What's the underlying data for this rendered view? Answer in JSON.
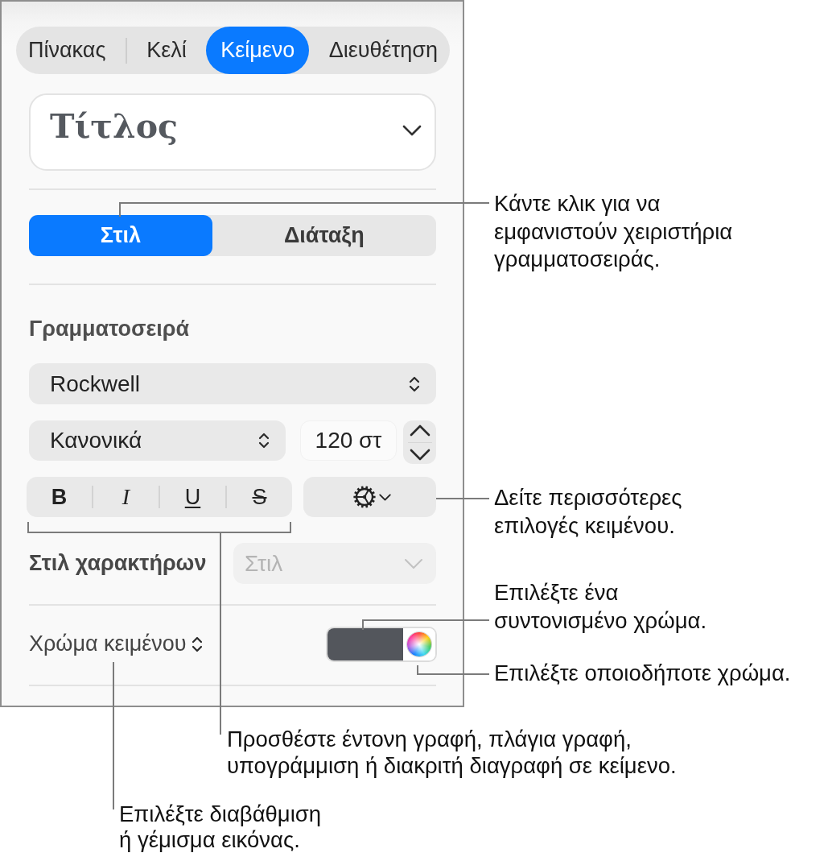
{
  "inspector_tabs": [
    {
      "label": "Πίνακας",
      "selected": false
    },
    {
      "label": "Κελί",
      "selected": false
    },
    {
      "label": "Κείμενο",
      "selected": true
    },
    {
      "label": "Διευθέτηση",
      "selected": false
    }
  ],
  "paragraph_style": {
    "value": "Τίτλος"
  },
  "mode_tabs": [
    {
      "label": "Στιλ",
      "selected": true
    },
    {
      "label": "Διάταξη",
      "selected": false
    }
  ],
  "font": {
    "heading": "Γραμματοσειρά",
    "family": "Rockwell",
    "typeface": "Κανονικά",
    "size": "120 στ",
    "format_buttons": [
      {
        "kind": "bold",
        "label": "B"
      },
      {
        "kind": "italic",
        "label": "I"
      },
      {
        "kind": "underline",
        "label": "U"
      },
      {
        "kind": "strikethrough",
        "label": "S"
      }
    ]
  },
  "character_style": {
    "label": "Στιλ χαρακτήρων",
    "value": "Στιλ",
    "disabled": true
  },
  "text_color": {
    "label": "Χρώμα κειμένου",
    "color": "#53565c"
  },
  "callouts": [
    {
      "text": "Κάντε κλικ για να εμφανιστούν χειριστήρια γραμματοσειράς."
    },
    {
      "text": "Δείτε περισσότερες επιλογές κειμένου."
    },
    {
      "text": "Επιλέξτε ένα συντονισμένο χρώμα."
    },
    {
      "text": "Επιλέξτε οποιοδήποτε χρώμα."
    },
    {
      "text": "Προσθέστε έντονη γραφή, πλάγια γραφή, υπογράμμιση ή διακριτή διαγραφή σε κείμενο."
    },
    {
      "text": "Επιλέξτε διαβάθμιση ή γέμισμα εικόνας."
    }
  ]
}
